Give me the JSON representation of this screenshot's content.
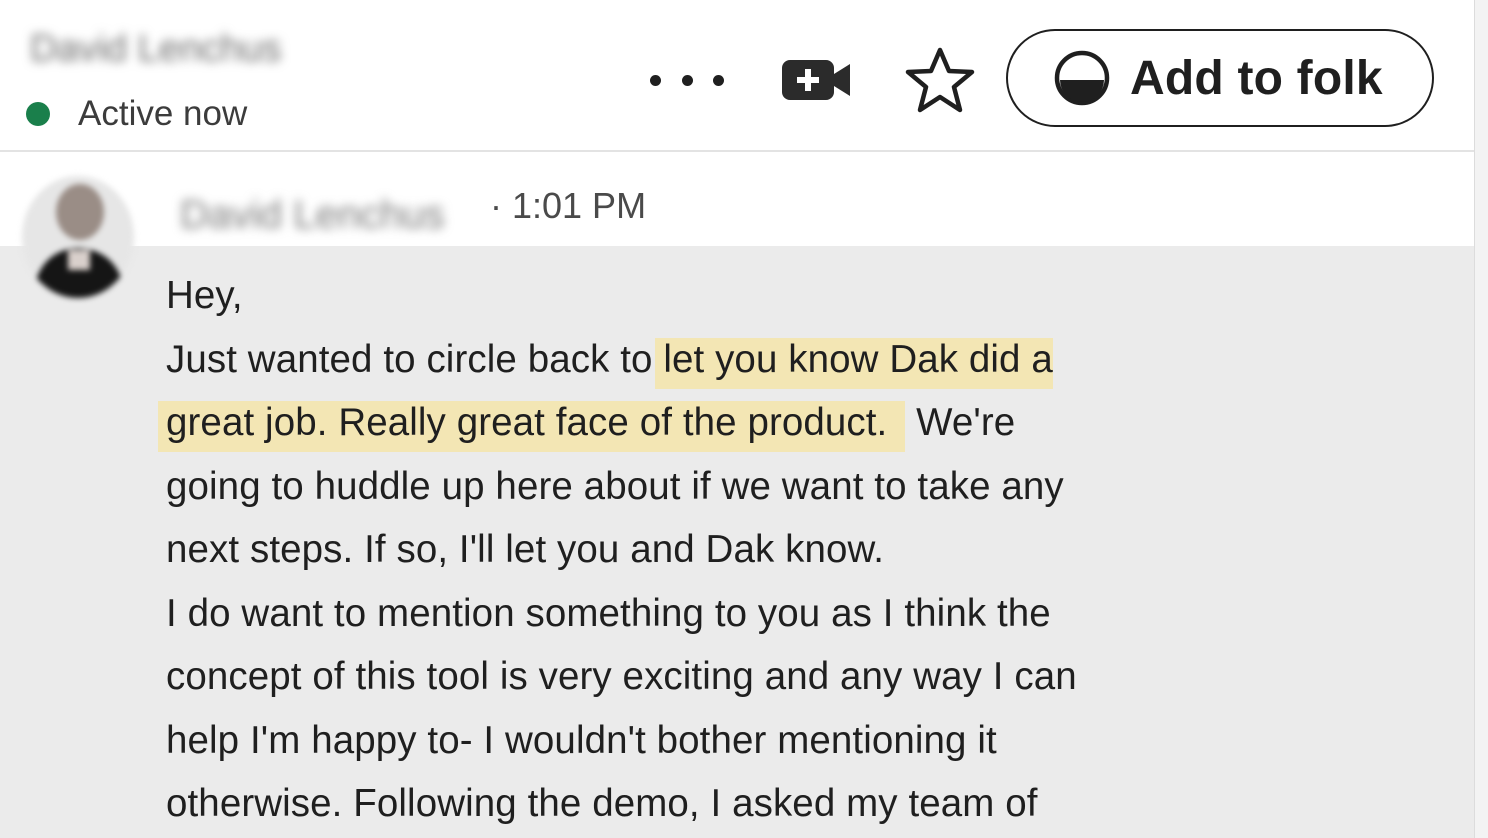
{
  "header": {
    "contact_name": "David Lenchus",
    "status_text": "Active now",
    "status_color": "#1a7f4b",
    "actions": {
      "more_icon": "more-horizontal-icon",
      "video_icon": "video-add-icon",
      "star_icon": "star-outline-icon",
      "folk_button_label": "Add to folk",
      "folk_icon": "folk-logo-icon"
    }
  },
  "message": {
    "sender_name": "David Lenchus",
    "time": "· 1:01 PM",
    "highlight_color": "#f3e6b4",
    "lines": {
      "l1": "Hey,",
      "l2a": "Just wanted to circle back to ",
      "l2b": "let you know Dak did a",
      "l3a": "great job. Really great face of the product.",
      "l3b": " We're",
      "l4": "going to huddle up here about if we want to take any",
      "l5": "next steps. If so, I'll let you and Dak know.",
      "l6": "I do want to mention something to you as I think the",
      "l7": "concept of this tool is very exciting  and any way I can",
      "l8": "help I'm happy to-  I wouldn't bother mentioning it",
      "l9": "otherwise.  Following the demo, I asked my team of"
    }
  }
}
